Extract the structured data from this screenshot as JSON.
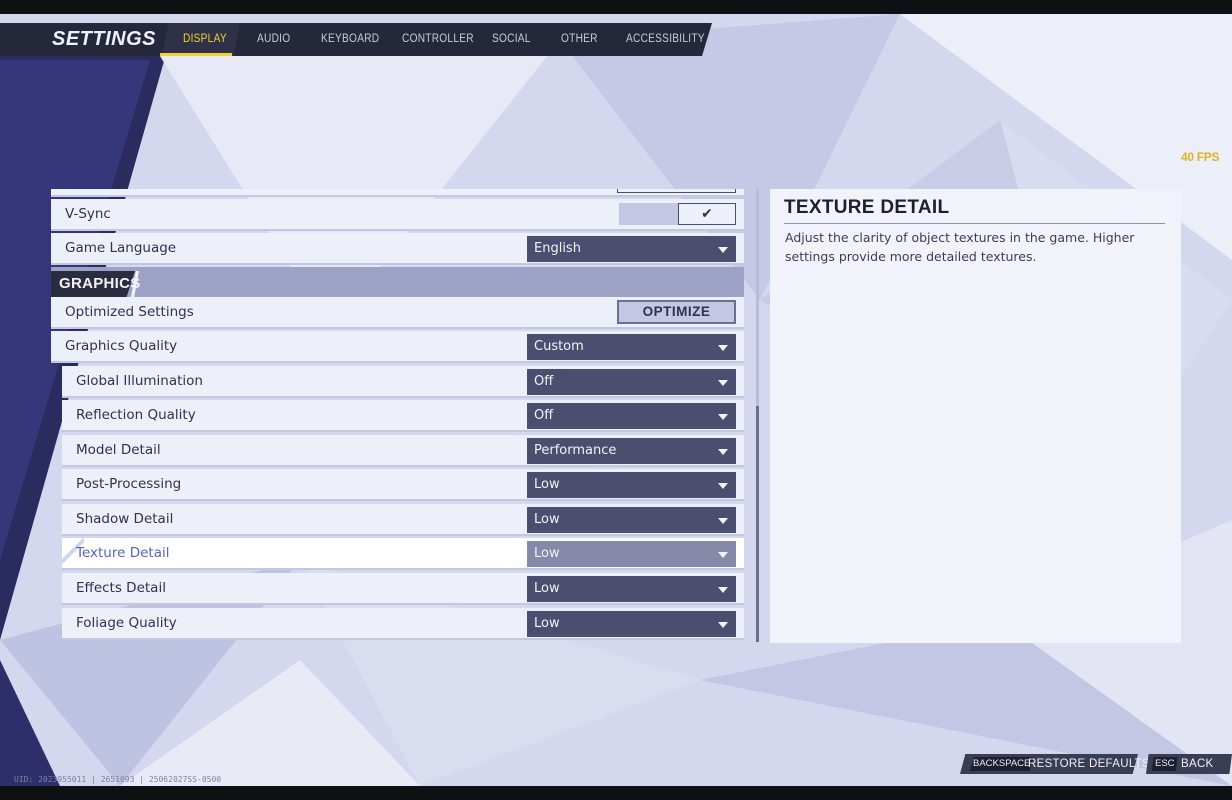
{
  "header": {
    "title": "SETTINGS",
    "tabs": [
      "DISPLAY",
      "AUDIO",
      "KEYBOARD",
      "CONTROLLER",
      "SOCIAL",
      "OTHER",
      "ACCESSIBILITY"
    ],
    "active_tab": "DISPLAY"
  },
  "fps": "40 FPS",
  "settings": {
    "vsync_label": "V-Sync",
    "vsync_value": "✔",
    "game_language_label": "Game Language",
    "game_language_value": "English",
    "graphics_section": "GRAPHICS",
    "optimized_label": "Optimized Settings",
    "optimize_button": "OPTIMIZE",
    "graphics_quality_label": "Graphics Quality",
    "graphics_quality_value": "Custom",
    "global_illumination_label": "Global Illumination",
    "global_illumination_value": "Off",
    "reflection_quality_label": "Reflection Quality",
    "reflection_quality_value": "Off",
    "model_detail_label": "Model Detail",
    "model_detail_value": "Performance",
    "post_processing_label": "Post-Processing",
    "post_processing_value": "Low",
    "shadow_detail_label": "Shadow Detail",
    "shadow_detail_value": "Low",
    "texture_detail_label": "Texture Detail",
    "texture_detail_value": "Low",
    "effects_detail_label": "Effects Detail",
    "effects_detail_value": "Low",
    "foliage_quality_label": "Foliage Quality",
    "foliage_quality_value": "Low"
  },
  "description": {
    "title": "TEXTURE DETAIL",
    "text": "Adjust the clarity of object textures in the game. Higher settings provide more detailed textures."
  },
  "footer": {
    "restore_key": "BACKSPACE",
    "restore_label": "RESTORE DEFAULTS",
    "back_key": "ESC",
    "back_label": "BACK",
    "uid": "UID: 2023955011 | 2651093 | 25062027SS-0500"
  },
  "colors": {
    "accent": "#f5d234",
    "panel": "#eef0f9",
    "dropdown": "#4b4e6e",
    "selected_text": "#4f67c6"
  }
}
